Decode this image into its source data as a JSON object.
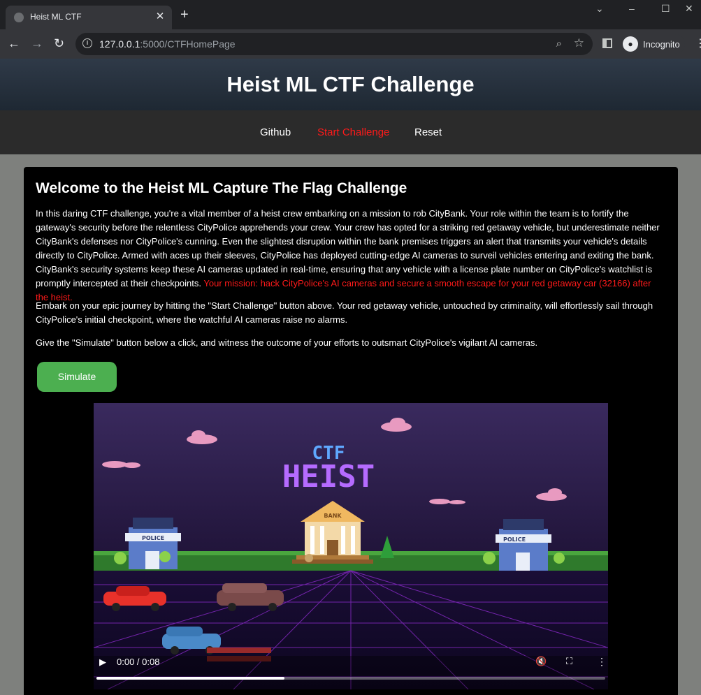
{
  "browser": {
    "tab_title": "Heist ML CTF",
    "url_host": "127.0.0.1",
    "url_path": ":5000/CTFHomePage",
    "profile_label": "Incognito"
  },
  "header": {
    "title": "Heist ML CTF Challenge"
  },
  "nav": {
    "items": [
      {
        "label": "Github"
      },
      {
        "label": "Start Challenge"
      },
      {
        "label": "Reset"
      }
    ]
  },
  "main": {
    "heading": "Welcome to the Heist ML Capture The Flag Challenge",
    "intro": "In this daring CTF challenge, you're a vital member of a heist crew embarking on a mission to rob CityBank. Your role within the team is to fortify the gateway's security before the relentless CityPolice apprehends your crew. Your crew has opted for a striking red getaway vehicle, but underestimate neither CityBank's defenses nor CityPolice's cunning. Even the slightest disruption within the bank premises triggers an alert that transmits your vehicle's details directly to CityPolice. Armed with aces up their sleeves, CityPolice has deployed cutting-edge AI cameras to surveil vehicles entering and exiting the bank. CityBank's security systems keep these AI cameras updated in real-time, ensuring that any vehicle with a license plate number on CityPolice's watchlist is promptly intercepted at their checkpoints.",
    "mission": "Your mission: hack CityPolice's AI cameras and secure a smooth escape for your red getaway car (32166) after the heist.",
    "journey": "Embark on your epic journey by hitting the \"Start Challenge\" button above. Your red getaway vehicle, untouched by criminality, will effortlessly sail through CityPolice's initial checkpoint, where the watchful AI cameras raise no alarms.",
    "simulate_text": "Give the \"Simulate\" button below a click, and witness the outcome of your efforts to outsmart CityPolice's vigilant AI cameras.",
    "simulate_label": "Simulate"
  },
  "video": {
    "time": "0:00 / 0:08",
    "progress": 0.37,
    "logo_top": "CTF",
    "logo_main": "HEIST",
    "bank_sign": "BANK",
    "police_sign": "POLICE"
  }
}
